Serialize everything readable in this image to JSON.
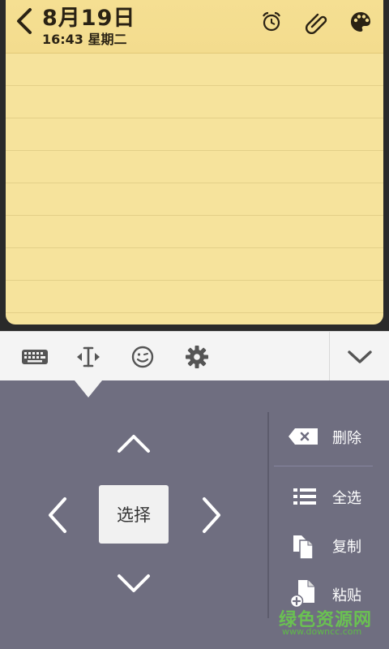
{
  "note": {
    "date": "8月19日",
    "time": "16:43 星期二"
  },
  "header_icons": [
    "back-chevron-icon",
    "alarm-icon",
    "paperclip-icon",
    "palette-icon"
  ],
  "toolbar": {
    "icons": [
      "keyboard-icon",
      "text-cursor-icon",
      "emoji-icon",
      "settings-gear-icon",
      "chevron-down-icon"
    ]
  },
  "panel": {
    "select_label": "选择",
    "actions": [
      {
        "label": "删除",
        "icon": "backspace-icon"
      },
      {
        "label": "全选",
        "icon": "list-icon"
      },
      {
        "label": "复制",
        "icon": "copy-icon"
      },
      {
        "label": "粘贴",
        "icon": "paste-icon"
      }
    ]
  },
  "watermark": {
    "main": "绿色资源网",
    "sub": "www.downcc.com"
  },
  "colors": {
    "note_paper": "#f6e39c",
    "panel_bg": "#6f6e80",
    "toolbar_bg": "#f4f4f4"
  }
}
